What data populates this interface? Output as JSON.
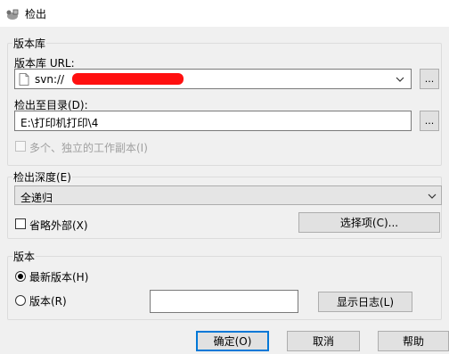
{
  "window": {
    "title": "检出"
  },
  "repository": {
    "group_label": "版本库",
    "url_label": "版本库 URL:",
    "url_value": "svn://",
    "checkout_dir_label": "检出至目录(D):",
    "checkout_dir_value": "E:\\打印机打印\\4",
    "browse_label": "...",
    "independent_copy_label": "多个、独立的工作副本(I)"
  },
  "depth": {
    "group_label": "检出深度(E)",
    "selected": "全递归",
    "omit_externals_label": "省略外部(X)",
    "choose_items_label": "选择项(C)..."
  },
  "revision": {
    "group_label": "版本",
    "head_label": "最新版本(H)",
    "revision_label": "版本(R)",
    "revision_value": "",
    "show_log_label": "显示日志(L)"
  },
  "buttons": {
    "ok_label": "确定(O)",
    "cancel_label": "取消",
    "help_label": "帮助"
  }
}
